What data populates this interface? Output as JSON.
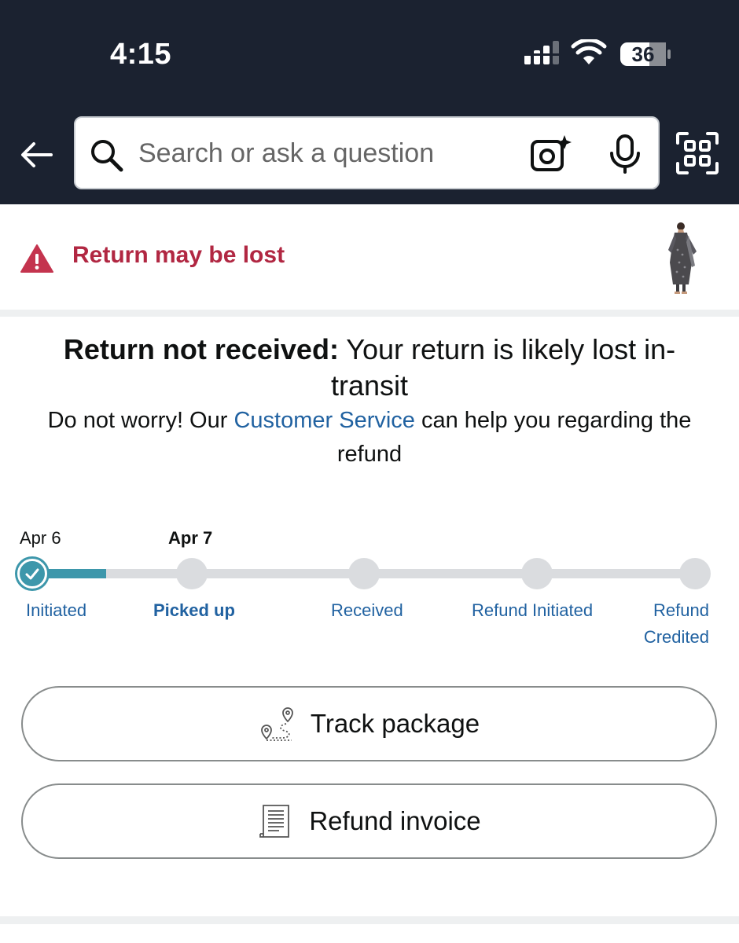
{
  "status_bar": {
    "time": "4:15",
    "battery": "36"
  },
  "header": {
    "search": {
      "placeholder": "Search or ask a question"
    }
  },
  "alert": {
    "title": "Return may be lost"
  },
  "message": {
    "head_bold": "Return not received:",
    "head_rest": " Your return is likely lost in-transit",
    "sub_before": "Do not worry! Our ",
    "sub_link": "Customer Service",
    "sub_after": " can help you regarding the refund"
  },
  "tracker": {
    "progress": 0.11,
    "dates": [
      {
        "label": "Apr 6"
      },
      {
        "label": "Apr 7"
      }
    ],
    "steps": [
      {
        "label": "Initiated",
        "state": "done"
      },
      {
        "label": "Picked up",
        "state": "current"
      },
      {
        "label": "Received",
        "state": "pending"
      },
      {
        "label": "Refund Initiated",
        "state": "pending"
      },
      {
        "label": "Refund Credited",
        "state": "pending"
      }
    ]
  },
  "actions": {
    "track": {
      "label": "Track package",
      "icon": "route-pin-icon"
    },
    "invoice": {
      "label": "Refund invoice",
      "icon": "document-icon"
    }
  },
  "colors": {
    "header_bg": "#1b2230",
    "alert_red": "#b12742",
    "link_blue": "#2162a1",
    "progress_teal": "#3d97ab",
    "track_gray": "#dadcdf"
  }
}
